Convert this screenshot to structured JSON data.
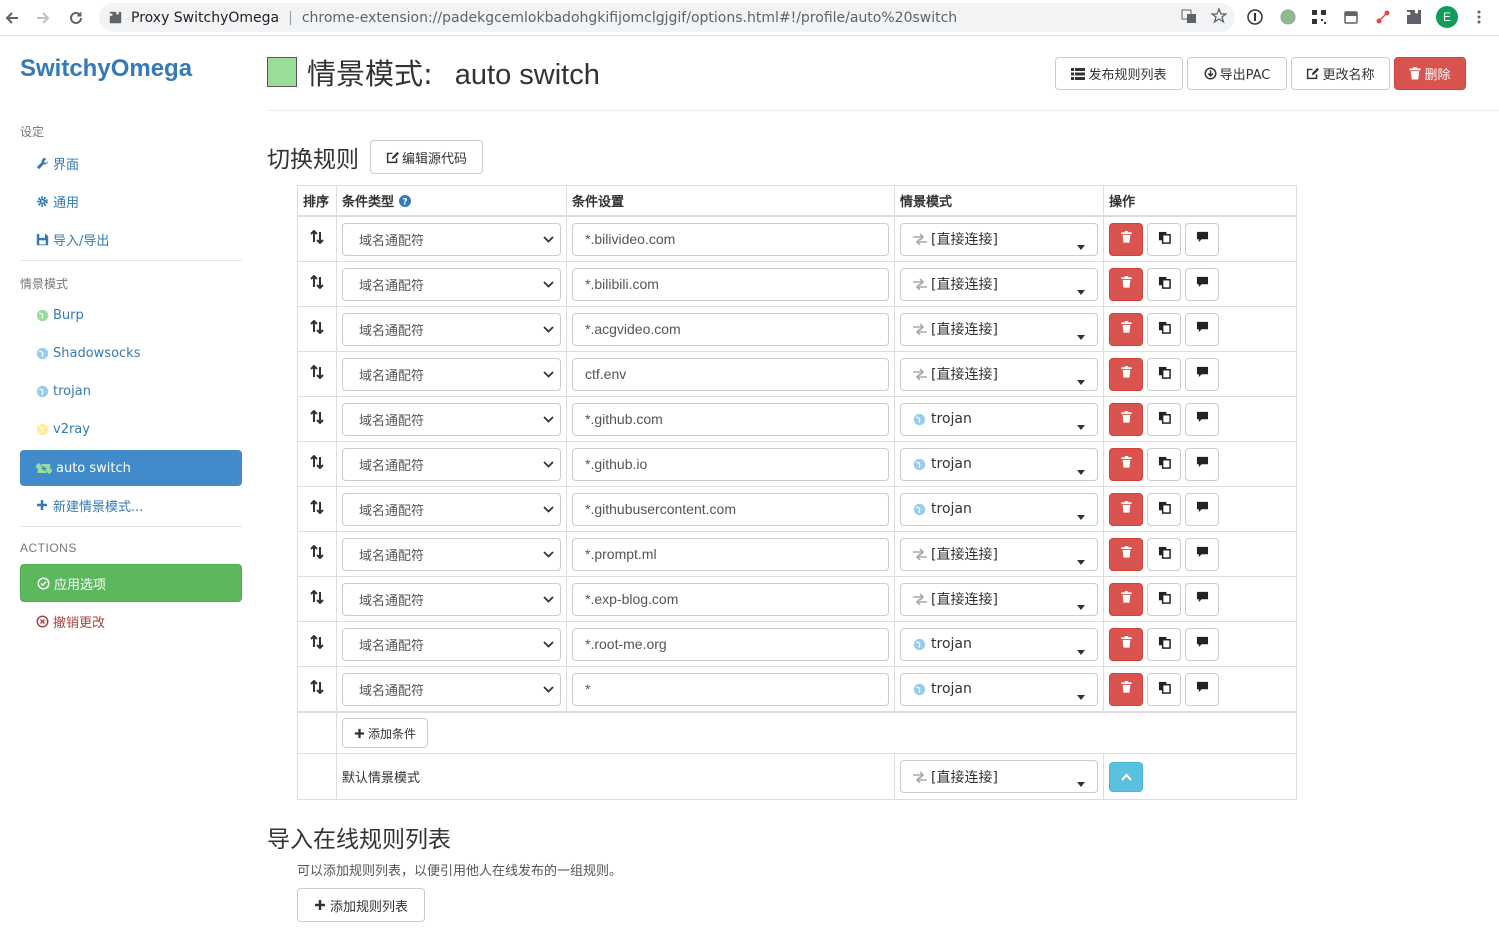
{
  "browser": {
    "tab_title": "Proxy SwitchyOmega",
    "url": "chrome-extension://padekgcemlokbadohgkifijomclgjgif/options.html#!/profile/auto%20switch",
    "avatar_letter": "E"
  },
  "sidebar": {
    "logo": "SwitchyOmega",
    "settings_header": "设定",
    "settings_items": [
      {
        "label": "界面",
        "icon": "wrench-icon"
      },
      {
        "label": "通用",
        "icon": "gear-icon"
      },
      {
        "label": "导入/导出",
        "icon": "floppy-icon"
      }
    ],
    "profiles_header": "情景模式",
    "profiles": [
      {
        "label": "Burp",
        "color": "#99dd99"
      },
      {
        "label": "Shadowsocks",
        "color": "#99ccee"
      },
      {
        "label": "trojan",
        "color": "#99ccee"
      },
      {
        "label": "v2ray",
        "color": "#ffee99"
      },
      {
        "label": "auto switch",
        "active": true
      }
    ],
    "new_profile": "新建情景模式...",
    "actions_header": "ACTIONS",
    "apply": "应用选项",
    "discard": "撤销更改"
  },
  "header": {
    "title_prefix": "情景模式:",
    "profile_name": "auto switch",
    "swatch_color": "#99dd99",
    "buttons": {
      "publish": "发布规则列表",
      "export_pac": "导出PAC",
      "rename": "更改名称",
      "delete": "删除"
    }
  },
  "rules_section": {
    "title": "切换规则",
    "edit_source": "编辑源代码",
    "columns": {
      "sort": "排序",
      "condition_type": "条件类型",
      "condition": "条件设置",
      "profile": "情景模式",
      "actions": "操作"
    },
    "rows": [
      {
        "type": "域名通配符",
        "condition": "*.bilivideo.com",
        "profile": "[直接连接]",
        "direct": true
      },
      {
        "type": "域名通配符",
        "condition": "*.bilibili.com",
        "profile": "[直接连接]",
        "direct": true
      },
      {
        "type": "域名通配符",
        "condition": "*.acgvideo.com",
        "profile": "[直接连接]",
        "direct": true
      },
      {
        "type": "域名通配符",
        "condition": "ctf.env",
        "profile": "[直接连接]",
        "direct": true
      },
      {
        "type": "域名通配符",
        "condition": "*.github.com",
        "profile": "trojan",
        "direct": false
      },
      {
        "type": "域名通配符",
        "condition": "*.github.io",
        "profile": "trojan",
        "direct": false
      },
      {
        "type": "域名通配符",
        "condition": "*.githubusercontent.com",
        "profile": "trojan",
        "direct": false
      },
      {
        "type": "域名通配符",
        "condition": "*.prompt.ml",
        "profile": "[直接连接]",
        "direct": true
      },
      {
        "type": "域名通配符",
        "condition": "*.exp-blog.com",
        "profile": "[直接连接]",
        "direct": true
      },
      {
        "type": "域名通配符",
        "condition": "*.root-me.org",
        "profile": "trojan",
        "direct": false
      },
      {
        "type": "域名通配符",
        "condition": "*",
        "profile": "trojan",
        "direct": false
      }
    ],
    "add_condition": "添加条件",
    "default_label": "默认情景模式",
    "default_profile": "[直接连接]"
  },
  "import_section": {
    "title": "导入在线规则列表",
    "description": "可以添加规则列表，以便引用他人在线发布的一组规则。",
    "add_list": "添加规则列表"
  },
  "colors": {
    "primary": "#337ab7",
    "active": "#428bca",
    "success": "#5cb85c",
    "danger": "#d9534f",
    "info": "#5bc0de"
  }
}
